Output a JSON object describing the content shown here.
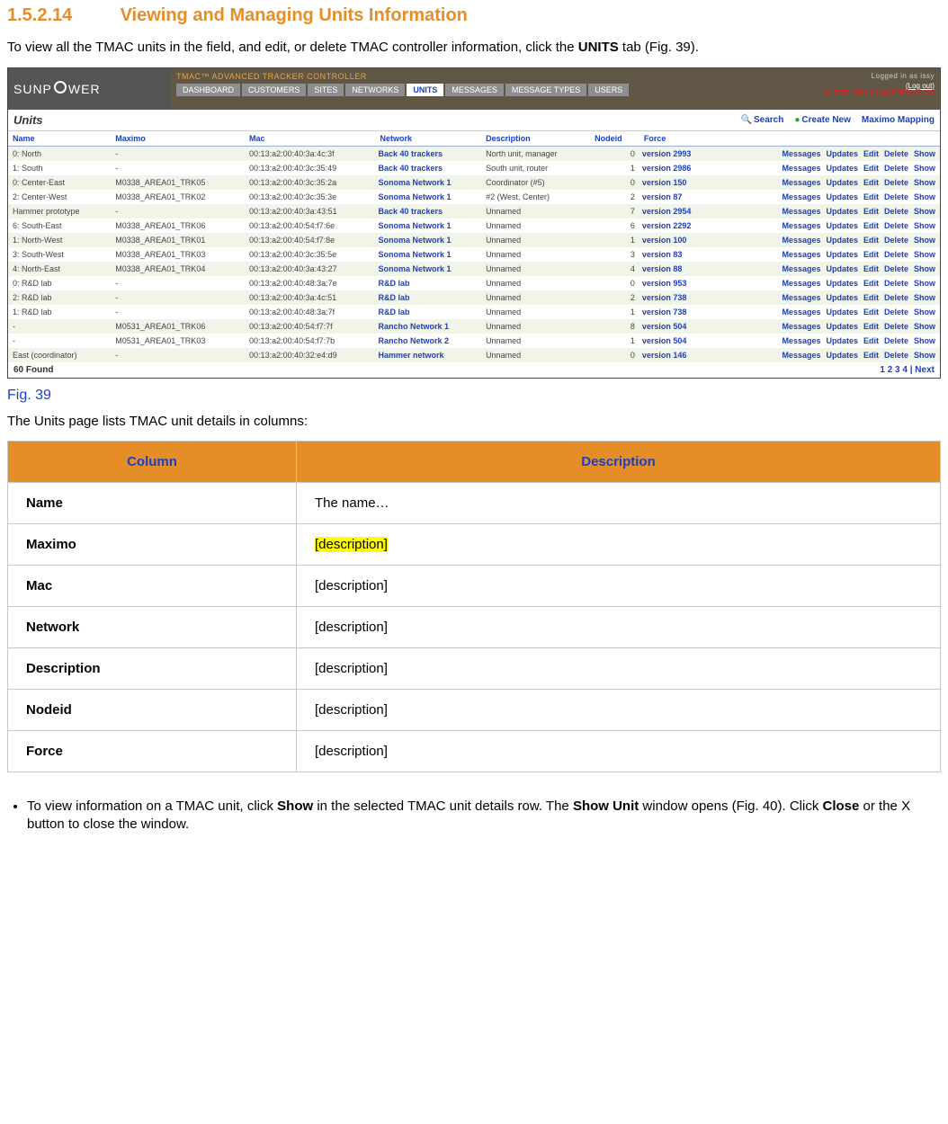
{
  "heading": {
    "num": "1.5.2.14",
    "title": "Viewing and Managing Units Information"
  },
  "intro1": "To view all the TMAC units in the field, and edit, or delete TMAC controller information, click the ",
  "intro_bold1": "UNITS",
  "intro2": " tab (Fig. 39).",
  "fig_label": "Fig. 39",
  "after_fig": "The Units page lists TMAC unit details in columns:",
  "ss": {
    "logo": "SUNPOWER",
    "top_title": "TMAC™ ADVANCED TRACKER CONTROLLER",
    "logged_in": "Logged in as issy",
    "logout": "(Log out)",
    "alert": "ALERT: 2361 UNMAPPED UNITS",
    "tabs": [
      "DASHBOARD",
      "CUSTOMERS",
      "SITES",
      "NETWORKS",
      "UNITS",
      "MESSAGES",
      "MESSAGE TYPES",
      "USERS"
    ],
    "active_tab_index": 4,
    "units_title": "Units",
    "toolbar": {
      "search": "Search",
      "create": "Create New",
      "maximo": "Maximo Mapping"
    },
    "headers": [
      "Name",
      "Maximo",
      "Mac",
      "Network",
      "Description",
      "Nodeid",
      "Force"
    ],
    "action_labels": [
      "Messages",
      "Updates",
      "Edit",
      "Delete",
      "Show"
    ],
    "rows": [
      {
        "name": "0: North",
        "maximo": "-",
        "mac": "00:13:a2:00:40:3a:4c:3f",
        "network": "Back 40 trackers",
        "description": "North unit, manager",
        "nodeid": "0",
        "force": "version 2993"
      },
      {
        "name": "1: South",
        "maximo": "-",
        "mac": "00:13:a2:00:40:3c:35:49",
        "network": "Back 40 trackers",
        "description": "South unit, router",
        "nodeid": "1",
        "force": "version 2986"
      },
      {
        "name": "0: Center-East",
        "maximo": "M0338_AREA01_TRK05",
        "mac": "00:13:a2:00:40:3c:35:2a",
        "network": "Sonoma Network 1",
        "description": "Coordinator (#5)",
        "nodeid": "0",
        "force": "version 150"
      },
      {
        "name": "2: Center-West",
        "maximo": "M0338_AREA01_TRK02",
        "mac": "00:13:a2:00:40:3c:35:3e",
        "network": "Sonoma Network 1",
        "description": "#2 (West, Center)",
        "nodeid": "2",
        "force": "version 87"
      },
      {
        "name": "Hammer prototype",
        "maximo": "-",
        "mac": "00:13:a2:00:40:3a:43:51",
        "network": "Back 40 trackers",
        "description": "Unnamed",
        "nodeid": "7",
        "force": "version 2954"
      },
      {
        "name": "6: South-East",
        "maximo": "M0338_AREA01_TRK06",
        "mac": "00:13:a2:00:40:54:f7:6e",
        "network": "Sonoma Network 1",
        "description": "Unnamed",
        "nodeid": "6",
        "force": "version 2292"
      },
      {
        "name": "1: North-West",
        "maximo": "M0338_AREA01_TRK01",
        "mac": "00:13:a2:00:40:54:f7:8e",
        "network": "Sonoma Network 1",
        "description": "Unnamed",
        "nodeid": "1",
        "force": "version 100"
      },
      {
        "name": "3: South-West",
        "maximo": "M0338_AREA01_TRK03",
        "mac": "00:13:a2:00:40:3c:35:5e",
        "network": "Sonoma Network 1",
        "description": "Unnamed",
        "nodeid": "3",
        "force": "version 83"
      },
      {
        "name": "4: North-East",
        "maximo": "M0338_AREA01_TRK04",
        "mac": "00:13:a2:00:40:3a:43:27",
        "network": "Sonoma Network 1",
        "description": "Unnamed",
        "nodeid": "4",
        "force": "version 88"
      },
      {
        "name": "0: R&D lab",
        "maximo": "-",
        "mac": "00:13:a2:00:40:48:3a:7e",
        "network": "R&D lab",
        "description": "Unnamed",
        "nodeid": "0",
        "force": "version 953"
      },
      {
        "name": "2: R&D lab",
        "maximo": "-",
        "mac": "00:13:a2:00:40:3a:4c:51",
        "network": "R&D lab",
        "description": "Unnamed",
        "nodeid": "2",
        "force": "version 738"
      },
      {
        "name": "1: R&D lab",
        "maximo": "-",
        "mac": "00:13:a2:00:40:48:3a:7f",
        "network": "R&D lab",
        "description": "Unnamed",
        "nodeid": "1",
        "force": "version 738"
      },
      {
        "name": "-",
        "maximo": "M0531_AREA01_TRK06",
        "mac": "00:13:a2:00:40:54:f7:7f",
        "network": "Rancho Network 1",
        "description": "Unnamed",
        "nodeid": "8",
        "force": "version 504"
      },
      {
        "name": "-",
        "maximo": "M0531_AREA01_TRK03",
        "mac": "00:13:a2:00:40:54:f7:7b",
        "network": "Rancho Network 2",
        "description": "Unnamed",
        "nodeid": "1",
        "force": "version 504"
      },
      {
        "name": "East (coordinator)",
        "maximo": "-",
        "mac": "00:13:a2:00:40:32:e4:d9",
        "network": "Hammer network",
        "description": "Unnamed",
        "nodeid": "0",
        "force": "version 146"
      }
    ],
    "found": "60 Found",
    "pager": "1 2 3 4 | Next"
  },
  "desc_table": {
    "headers": [
      "Column",
      "Description"
    ],
    "rows": [
      {
        "col": "Name",
        "desc": "The name…",
        "hl": false
      },
      {
        "col": "Maximo",
        "desc": "[description]",
        "hl": true
      },
      {
        "col": "Mac",
        "desc": "[description]",
        "hl": false
      },
      {
        "col": "Network",
        "desc": "[description]",
        "hl": false
      },
      {
        "col": "Description",
        "desc": "[description]",
        "hl": false
      },
      {
        "col": "Nodeid",
        "desc": "[description]",
        "hl": false
      },
      {
        "col": "Force",
        "desc": "[description]",
        "hl": false
      }
    ]
  },
  "bullet1a": "To view information on a TMAC unit, click ",
  "bullet1_bold1": "Show",
  "bullet1b": " in the selected TMAC unit details row. The ",
  "bullet1_bold2": "Show Unit",
  "bullet1c": " window opens (Fig. 40). Click ",
  "bullet1_bold3": "Close",
  "bullet1d": " or the X button to close the window."
}
